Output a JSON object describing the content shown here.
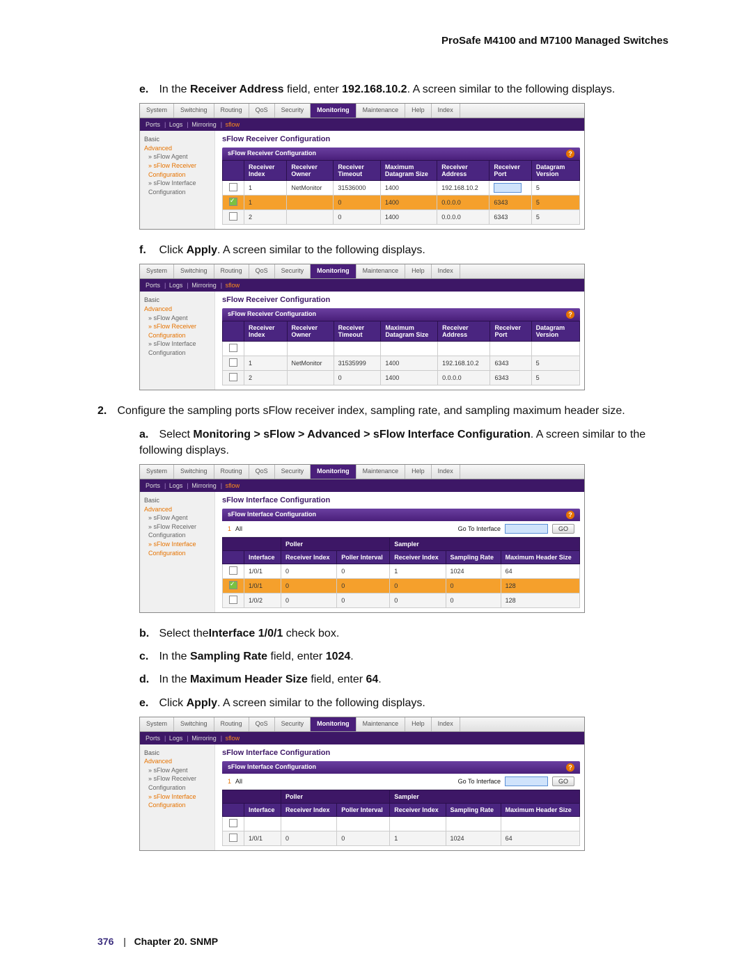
{
  "header": {
    "title": "ProSafe M4100 and M7100 Managed Switches"
  },
  "instr_e": {
    "marker": "e.",
    "pre": "In the ",
    "bold1": "Receiver Address",
    "mid": " field, enter ",
    "bold2": "192.168.10.2",
    "post": ". A screen similar to the following displays."
  },
  "instr_f": {
    "marker": "f.",
    "pre": "Click ",
    "bold1": "Apply",
    "post": ". A screen similar to the following displays."
  },
  "instr_2": {
    "marker": "2.",
    "text": "Configure the sampling ports sFlow receiver index, sampling rate, and sampling maximum header size."
  },
  "instr_2a": {
    "marker": "a.",
    "pre": "Select ",
    "bold1": "Monitoring > sFlow > Advanced > sFlow Interface Configuration",
    "post": ". A screen similar to the following displays."
  },
  "instr_2b": {
    "marker": "b.",
    "pre": "Select the",
    "bold1": "Interface 1/0/1",
    "post": " check box."
  },
  "instr_2c": {
    "marker": "c.",
    "pre": " In the ",
    "bold1": "Sampling Rate",
    "mid": " field, enter ",
    "bold2": "1024",
    "post": "."
  },
  "instr_2d": {
    "marker": "d.",
    "pre": "In the ",
    "bold1": "Maximum Header Size",
    "mid": " field, enter ",
    "bold2": "64",
    "post": "."
  },
  "instr_2e": {
    "marker": "e.",
    "pre": "Click ",
    "bold1": "Apply",
    "post": ". A screen similar to the following displays."
  },
  "tabs": [
    "System",
    "Switching",
    "Routing",
    "QoS",
    "Security",
    "Monitoring",
    "Maintenance",
    "Help",
    "Index"
  ],
  "subnav": {
    "items": [
      "Ports",
      "Logs",
      "Mirroring",
      "sflow"
    ],
    "active": "sflow"
  },
  "sidebar_recv": {
    "basic": "Basic",
    "advanced": "Advanced",
    "agent": "sFlow Agent",
    "recv_cfg": "sFlow Receiver Configuration",
    "iface_cfg": "sFlow Interface Configuration"
  },
  "recv_cfg_title": "sFlow Receiver Configuration",
  "recv_cfg_sub": "sFlow Receiver Configuration",
  "recv_headers": [
    "Receiver Index",
    "Receiver Owner",
    "Receiver Timeout",
    "Maximum Datagram Size",
    "Receiver Address",
    "Receiver Port",
    "Datagram Version"
  ],
  "shot1_rows": [
    {
      "chk": "on_header",
      "idx": "1",
      "owner": "NetMonitor",
      "timeout": "31536000",
      "dgram": "1400",
      "addr": "192.168.10.2",
      "port_input": true,
      "ver": "5"
    },
    {
      "chk": "on",
      "orange": true,
      "idx": "1",
      "owner": "",
      "timeout": "0",
      "dgram": "1400",
      "addr": "0.0.0.0",
      "port": "6343",
      "ver": "5"
    },
    {
      "chk": "off",
      "idx": "2",
      "owner": "",
      "timeout": "0",
      "dgram": "1400",
      "addr": "0.0.0.0",
      "port": "6343",
      "ver": "5"
    }
  ],
  "shot2_rows": [
    {
      "chk": "off",
      "idx": "1",
      "owner": "NetMonitor",
      "timeout": "31535999",
      "dgram": "1400",
      "addr": "192.168.10.2",
      "port": "6343",
      "ver": "5"
    },
    {
      "chk": "off",
      "idx": "2",
      "owner": "",
      "timeout": "0",
      "dgram": "1400",
      "addr": "0.0.0.0",
      "port": "6343",
      "ver": "5"
    }
  ],
  "iface_cfg_title": "sFlow Interface Configuration",
  "iface_cfg_sub": "sFlow Interface Configuration",
  "filter_all": "All",
  "goto_label": "Go To Interface",
  "go": "GO",
  "group_poller": "Poller",
  "group_sampler": "Sampler",
  "iface_headers": [
    "Interface",
    "Receiver Index",
    "Poller Interval",
    "Receiver Index",
    "Sampling Rate",
    "Maximum Header Size"
  ],
  "shot3_rows": [
    {
      "chk": "off",
      "iface": "1/0/1",
      "p_idx": "0",
      "p_int": "0",
      "s_idx": "1",
      "rate": "1024",
      "hdr": "64"
    },
    {
      "chk": "on",
      "orange": true,
      "iface": "1/0/1",
      "p_idx": "0",
      "p_int": "0",
      "s_idx": "0",
      "rate": "0",
      "hdr": "128"
    },
    {
      "chk": "off",
      "iface": "1/0/2",
      "p_idx": "0",
      "p_int": "0",
      "s_idx": "0",
      "rate": "0",
      "hdr": "128"
    }
  ],
  "shot4_rows": [
    {
      "chk": "off",
      "iface": "1/0/1",
      "p_idx": "0",
      "p_int": "0",
      "s_idx": "1",
      "rate": "1024",
      "hdr": "64"
    }
  ],
  "footer": {
    "page": "376",
    "sep": "|",
    "chapter": "Chapter 20. SNMP"
  }
}
